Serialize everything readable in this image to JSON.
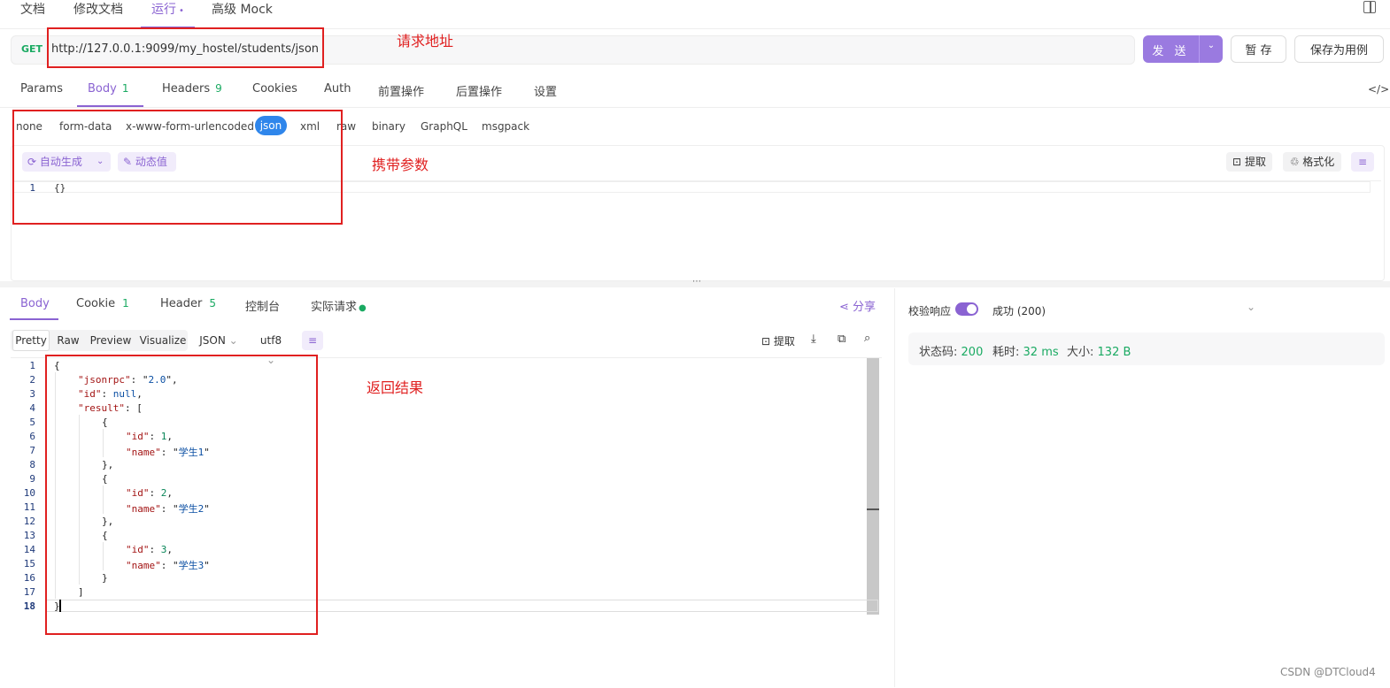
{
  "top_tabs": {
    "docs": "文档",
    "edit_docs": "修改文档",
    "run": "运行",
    "advanced_mock": "高级 Mock"
  },
  "request": {
    "method": "GET",
    "url": "http://127.0.0.1:9099/my_hostel/students/json",
    "send_label": "发 送",
    "save_temp_label": "暂 存",
    "save_case_label": "保存为用例"
  },
  "annotations": {
    "url_note": "请求地址",
    "params_note": "携带参数",
    "result_note": "返回结果"
  },
  "request_tabs": [
    {
      "label": "Params",
      "count": ""
    },
    {
      "label": "Body",
      "count": "1"
    },
    {
      "label": "Headers",
      "count": "9"
    },
    {
      "label": "Cookies",
      "count": ""
    },
    {
      "label": "Auth",
      "count": ""
    },
    {
      "label": "前置操作",
      "count": ""
    },
    {
      "label": "后置操作",
      "count": ""
    },
    {
      "label": "设置",
      "count": ""
    }
  ],
  "body_types": [
    "none",
    "form-data",
    "x-www-form-urlencoded",
    "json",
    "xml",
    "raw",
    "binary",
    "GraphQL",
    "msgpack"
  ],
  "body_toolbar": {
    "auto_generate": "自动生成",
    "dynamic_value": "动态值",
    "extract": "提取",
    "format": "格式化"
  },
  "request_body": {
    "line_number": "1",
    "content": "{}"
  },
  "response_tabs": [
    {
      "label": "Body",
      "count": ""
    },
    {
      "label": "Cookie",
      "count": "1"
    },
    {
      "label": "Header",
      "count": "5"
    },
    {
      "label": "控制台",
      "count": ""
    },
    {
      "label": "实际请求",
      "count": ""
    }
  ],
  "share_label": "分享",
  "response_toolbar": {
    "views": [
      "Pretty",
      "Raw",
      "Preview",
      "Visualize"
    ],
    "format": "JSON",
    "encoding": "utf8",
    "extract": "提取"
  },
  "response_body": {
    "line_numbers": [
      "1",
      "2",
      "3",
      "4",
      "5",
      "6",
      "7",
      "8",
      "9",
      "10",
      "11",
      "12",
      "13",
      "14",
      "15",
      "16",
      "17",
      "18"
    ],
    "jsonrpc": "2.0",
    "id": "null",
    "results": [
      {
        "id": "1",
        "name": "学生1"
      },
      {
        "id": "2",
        "name": "学生2"
      },
      {
        "id": "3",
        "name": "学生3"
      }
    ]
  },
  "validation": {
    "label": "校验响应",
    "toggle_on": true,
    "result": "成功 (200)"
  },
  "status": {
    "code_label": "状态码:",
    "code_value": "200",
    "time_label": "耗时:",
    "time_value": "32 ms",
    "size_label": "大小:",
    "size_value": "132 B"
  },
  "watermark": "CSDN @DTCloud4",
  "colors": {
    "accent": "#8a63d2",
    "success": "#1aaa62",
    "annotation": "#e02020",
    "json_pill": "#2f86eb"
  }
}
